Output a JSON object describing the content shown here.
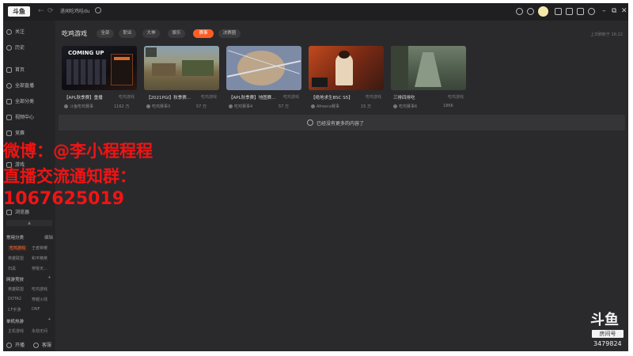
{
  "app": {
    "logo_text": "斗鱼"
  },
  "titlebar": {
    "back_arrow": "←",
    "refresh_arrow": "⟳",
    "search_value": "遂闻吃鸡哇du",
    "window_min": "–",
    "window_restore": "⧉",
    "window_close": "✕"
  },
  "sidebar": {
    "follow": "关注",
    "history": "历史",
    "home": "首页",
    "all_live": "全部直播",
    "all_categories": "全部分类",
    "video_center": "视频中心",
    "esports": "竞赛",
    "game": "游戏",
    "browser": "浏览器",
    "collapse": "▲",
    "section_common": "常用分类",
    "section_common_btn": "编辑",
    "common_items": [
      "吃鸡游戏",
      "王者荣耀",
      "英雄联盟",
      "和平精英",
      "扫黑",
      "穿梭天..."
    ],
    "section_online": "网游竞技",
    "online_items": [
      "英雄联盟",
      "吃鸡游戏",
      "DOTA2",
      "穿越火线",
      "CF手游",
      "DNF"
    ],
    "section_mobile": "单机热游",
    "mobile_items": [
      "主机游戏",
      "永劫无间"
    ],
    "bottom_left": "开播",
    "bottom_right": "客服"
  },
  "main": {
    "title": "吃鸡游戏",
    "chips": [
      "全部",
      "职业",
      "大神",
      "娱乐",
      "赛事",
      "决赛圈"
    ],
    "active_chip": 4,
    "update_text": "上次刷新于 16:22",
    "cards": [
      {
        "title": "【APL秋季赛】重播",
        "category": "吃鸡游戏",
        "streamer": "斗鱼吃鸡赛事",
        "views": "1162 万"
      },
      {
        "title": "【2021PGI】秋季赛...",
        "category": "吃鸡游戏",
        "streamer": "吃鸡赛事3",
        "views": "57 万"
      },
      {
        "title": "【APL秋季赛】地图赛...",
        "category": "吃鸡游戏",
        "streamer": "吃鸡赛事4",
        "views": "57 万"
      },
      {
        "title": "【绝地求生BSC S5】",
        "category": "吃鸡游戏",
        "streamer": "Afreeca赛事",
        "views": "15 万"
      },
      {
        "title": "三排四排吃",
        "category": "吃鸡游戏",
        "streamer": "吃鸡赛事6",
        "views": "1866"
      }
    ],
    "no_more": "已经没有更多的内容了"
  },
  "overlay": {
    "line1": "微博：@李小程程程",
    "line2": "直播交流通知群：",
    "line3": "1067625019"
  },
  "watermark": {
    "logo": "斗鱼",
    "badge": "房间号",
    "room_number": "3479824"
  },
  "colors": {
    "accent": "#ff5d23",
    "overlay_red": "#f01414",
    "bg": "#2a2a2d"
  }
}
